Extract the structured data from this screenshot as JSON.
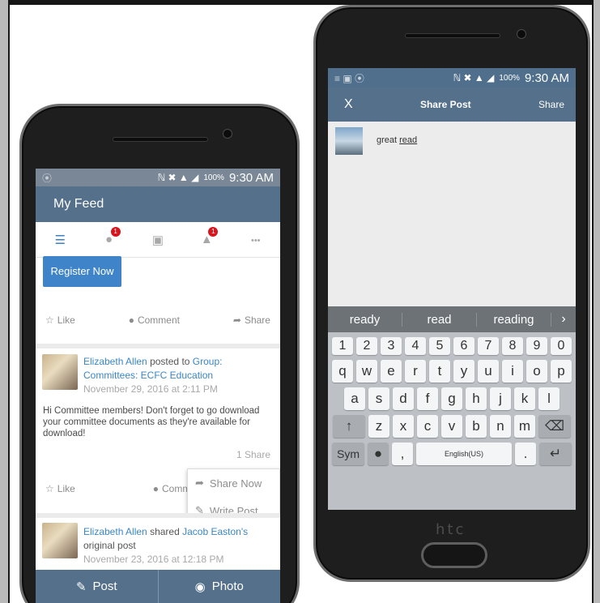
{
  "phone1": {
    "status": {
      "signal_left": "⦿",
      "icons": "ℕ ✖ ▲ ◢",
      "battery": "100%",
      "time": "9:30 AM"
    },
    "appbar": {
      "title": "My Feed"
    },
    "tabs": [
      {
        "name": "feed",
        "icon": "☰",
        "badge": ""
      },
      {
        "name": "people",
        "icon": "●",
        "badge": "1"
      },
      {
        "name": "briefcase",
        "icon": "▣",
        "badge": ""
      },
      {
        "name": "notifications",
        "icon": "▲",
        "badge": "1"
      },
      {
        "name": "more",
        "icon": "•••",
        "badge": ""
      }
    ],
    "register_button": "Register Now",
    "actions": {
      "like": "Like",
      "comment": "Comment",
      "share": "Share"
    },
    "post1": {
      "author": "Elizabeth Allen",
      "verb": "posted to",
      "group": "Group: Committees: ECFC Education",
      "date": "November 29, 2016 at 2:11 PM",
      "body": "Hi Committee members!  Don't forget to go download your committee documents as they're available for download!",
      "share_count": "1 Share"
    },
    "popup": {
      "share_now": "Share Now",
      "write_post": "Write Post"
    },
    "post2": {
      "author": "Elizabeth Allen",
      "verb": "shared",
      "target": "Jacob Easton's",
      "suffix": "original post",
      "date": "November 23, 2016 at 12:18 PM"
    },
    "bottom": {
      "post": "Post",
      "photo": "Photo"
    }
  },
  "phone2": {
    "status": {
      "left": "≡ ▣ ⦿",
      "icons": "ℕ ✖ ▲ ◢",
      "battery": "100%",
      "time": "9:30 AM"
    },
    "appbar": {
      "close": "X",
      "title": "Share Post",
      "action": "Share"
    },
    "compose": {
      "text_prefix": "great",
      "text_underlined": "read"
    },
    "suggestions": [
      "ready",
      "read",
      "reading"
    ],
    "suggest_more": "›",
    "keys_num": [
      "1",
      "2",
      "3",
      "4",
      "5",
      "6",
      "7",
      "8",
      "9",
      "0"
    ],
    "keys_row1": [
      "q",
      "w",
      "e",
      "r",
      "t",
      "y",
      "u",
      "i",
      "o",
      "p"
    ],
    "keys_row2": [
      "a",
      "s",
      "d",
      "f",
      "g",
      "h",
      "j",
      "k",
      "l"
    ],
    "keys_row3": [
      "z",
      "x",
      "c",
      "v",
      "b",
      "n",
      "m"
    ],
    "keys_bottom": {
      "sym": "Sym",
      "comma": ",",
      "space": "English(US)",
      "period": ".",
      "enter": "↵",
      "shift": "↑",
      "backspace": "⌫",
      "mic": "●"
    },
    "brand": "htc"
  },
  "colors": {
    "appbar": "#55708b",
    "link": "#3a86c6",
    "button": "#3f84c8",
    "badge": "#d8141c"
  }
}
